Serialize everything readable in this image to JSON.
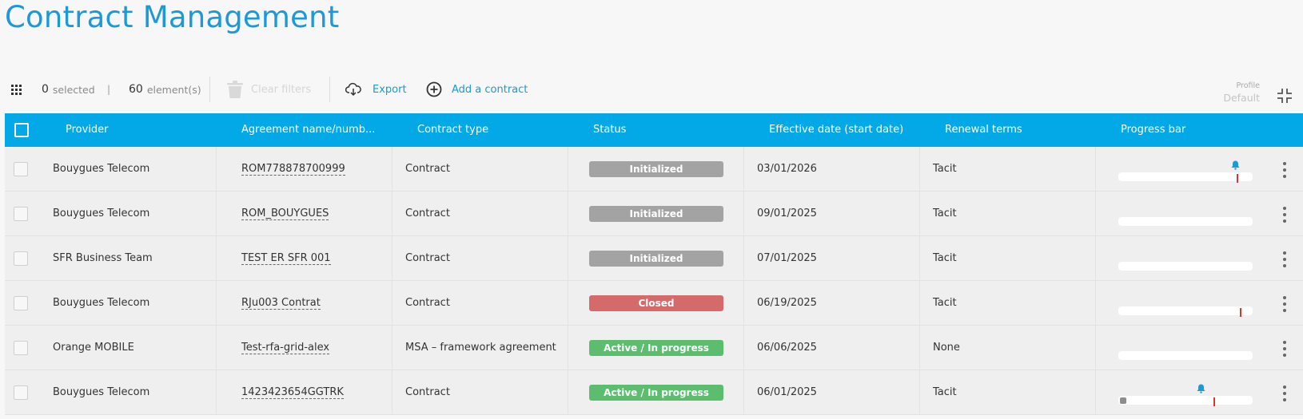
{
  "page": {
    "title": "Contract Management"
  },
  "toolbar": {
    "selected_count": "0",
    "selected_label": "selected",
    "separator": "|",
    "elements_count": "60",
    "elements_label": "element(s)",
    "clear_filters_label": "Clear filters",
    "export_label": "Export",
    "add_contract_label": "Add a contract",
    "profile_label": "Profile",
    "profile_value": "Default"
  },
  "table": {
    "columns": [
      "Provider",
      "Agreement name/numb...",
      "Contract type",
      "Status",
      "Effective date (start date)",
      "Renewal terms",
      "Progress bar"
    ],
    "rows": [
      {
        "provider": "Bouygues Telecom",
        "agreement": "ROM778878700999",
        "contract_type": "Contract",
        "status": "Initialized",
        "status_color": "#a3a3a3",
        "effective_date": "03/01/2026",
        "renewal": "Tacit",
        "progress": 0,
        "marker": true,
        "bell": true
      },
      {
        "provider": "Bouygues Telecom",
        "agreement": "ROM_BOUYGUES",
        "contract_type": "Contract",
        "status": "Initialized",
        "status_color": "#a3a3a3",
        "effective_date": "09/01/2025",
        "renewal": "Tacit",
        "progress": 0,
        "marker": false,
        "bell": false
      },
      {
        "provider": "SFR Business Team",
        "agreement": "TEST ER SFR 001",
        "contract_type": "Contract",
        "status": "Initialized",
        "status_color": "#a3a3a3",
        "effective_date": "07/01/2025",
        "renewal": "Tacit",
        "progress": 0,
        "marker": false,
        "bell": false
      },
      {
        "provider": "Bouygues Telecom",
        "agreement": "RJu003 Contrat",
        "contract_type": "Contract",
        "status": "Closed",
        "status_color": "#d46a6a",
        "effective_date": "06/19/2025",
        "renewal": "Tacit",
        "progress": 0,
        "marker": true,
        "bell": false
      },
      {
        "provider": "Orange MOBILE",
        "agreement": "Test-rfa-grid-alex",
        "contract_type": "MSA – framework agreement",
        "status": "Active / In progress",
        "status_color": "#5cbd6f",
        "effective_date": "06/06/2025",
        "renewal": "None",
        "progress": 0,
        "marker": false,
        "bell": false
      },
      {
        "provider": "Bouygues Telecom",
        "agreement": "1423423654GGTRK",
        "contract_type": "Contract",
        "status": "Active / In progress",
        "status_color": "#5cbd6f",
        "effective_date": "06/01/2025",
        "renewal": "Tacit",
        "progress": 0.05,
        "marker": true,
        "bell": true
      }
    ]
  },
  "colors": {
    "accent": "#1a9ad6",
    "header_bg": "#03a9e6",
    "initialized": "#a3a3a3",
    "closed": "#d46a6a",
    "active": "#5cbd6f",
    "marker": "#dd3333"
  },
  "icons": {
    "grid": "grid-icon",
    "trash": "trash-icon",
    "export": "cloud-download-icon",
    "add": "plus-circle-icon",
    "collapse": "collapse-icon",
    "bell": "bell-icon",
    "more": "kebab-icon"
  }
}
